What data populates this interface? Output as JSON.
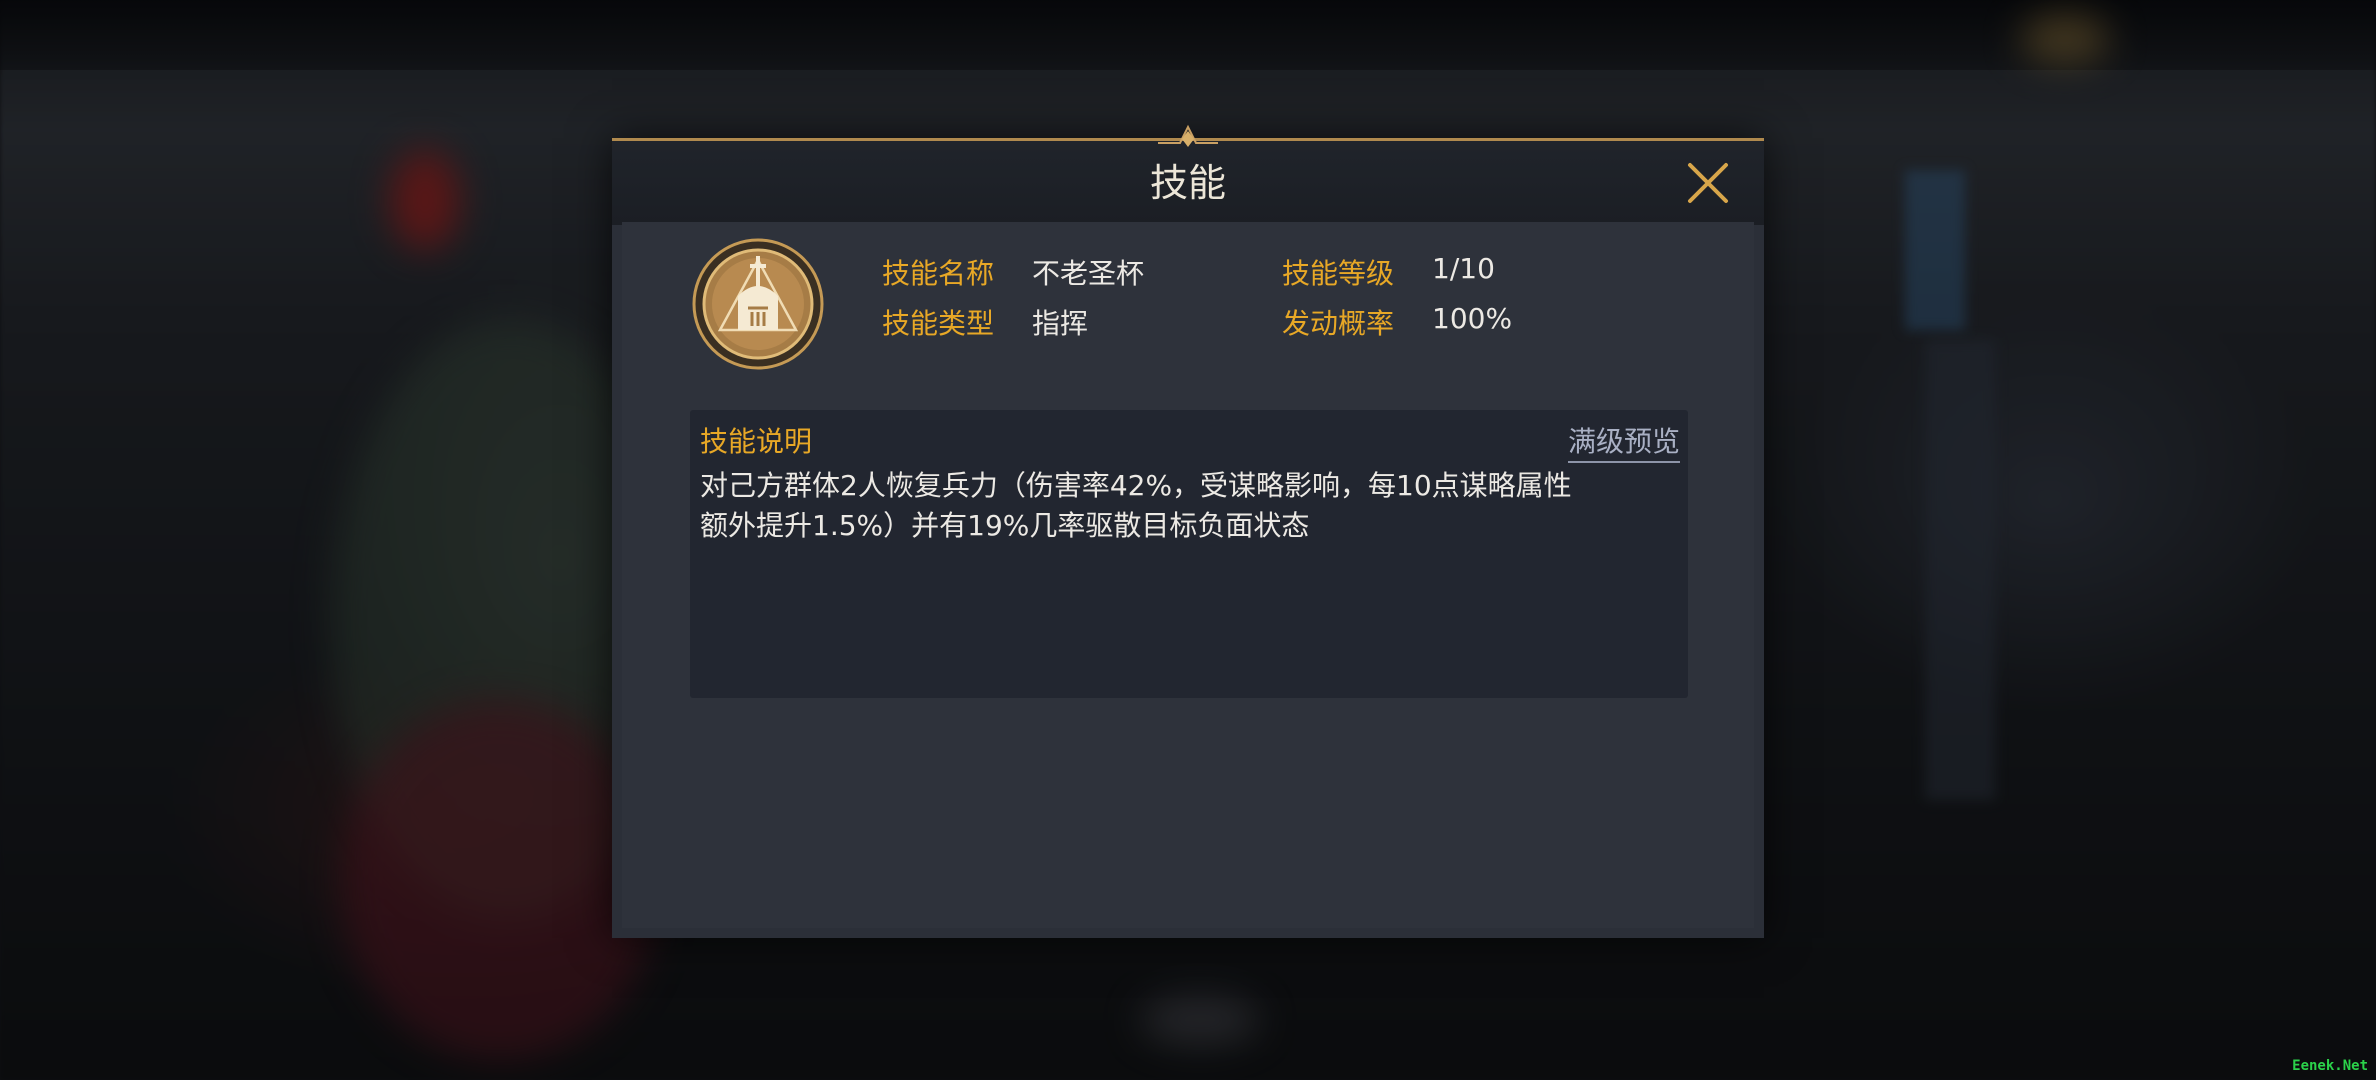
{
  "dialog": {
    "title": "技能",
    "close_icon": "close-icon"
  },
  "skill": {
    "icon": "knight-helmet-sword-icon",
    "name_label": "技能名称",
    "name_value": "不老圣杯",
    "level_label": "技能等级",
    "level_value": "1/10",
    "type_label": "技能类型",
    "type_value": "指挥",
    "chance_label": "发动概率",
    "chance_value": "100%"
  },
  "description": {
    "title": "技能说明",
    "preview_link": "满级预览",
    "line1": "对己方群体2人恢复兵力（伤害率42%，受谋略影响，每10点谋略属性",
    "line2": "额外提升1.5%）并有19%几率驱散目标负面状态"
  },
  "watermark": "Eenek.Net",
  "colors": {
    "accent_gold": "#e8a826",
    "border_gold": "#b08a4e",
    "panel": "#2b2f38",
    "text": "#ece9e4"
  }
}
